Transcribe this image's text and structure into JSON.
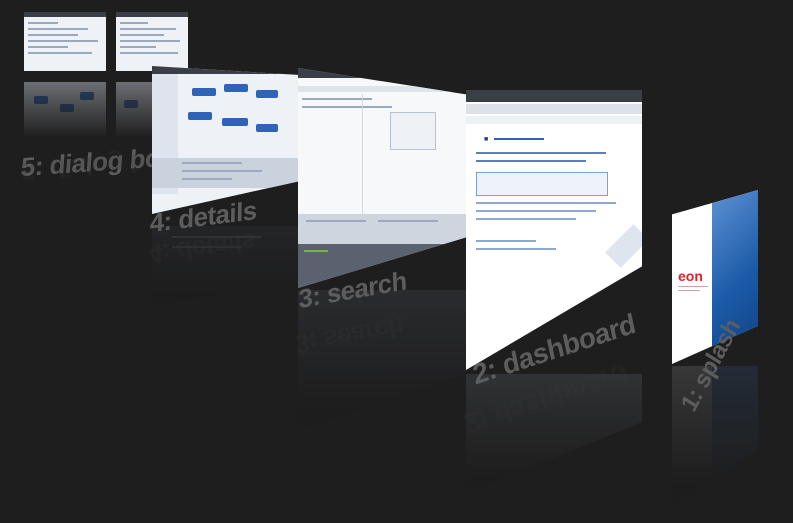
{
  "steps": [
    {
      "id": "dialog-box",
      "label": "5: dialog box"
    },
    {
      "id": "details",
      "label": "4: details"
    },
    {
      "id": "search",
      "label": "3: search"
    },
    {
      "id": "dashboard",
      "label": "2: dashboard"
    },
    {
      "id": "splash",
      "label": "1: splash"
    }
  ],
  "colors": {
    "background": "#1e1e1e",
    "label": "#5d5d5d",
    "window_chrome": "#3a3f47",
    "accent_blue": "#2e63b8",
    "splash_blue": "#1b5aa8",
    "splash_logo_red": "#d8262e"
  },
  "splash": {
    "logo": "eon"
  }
}
